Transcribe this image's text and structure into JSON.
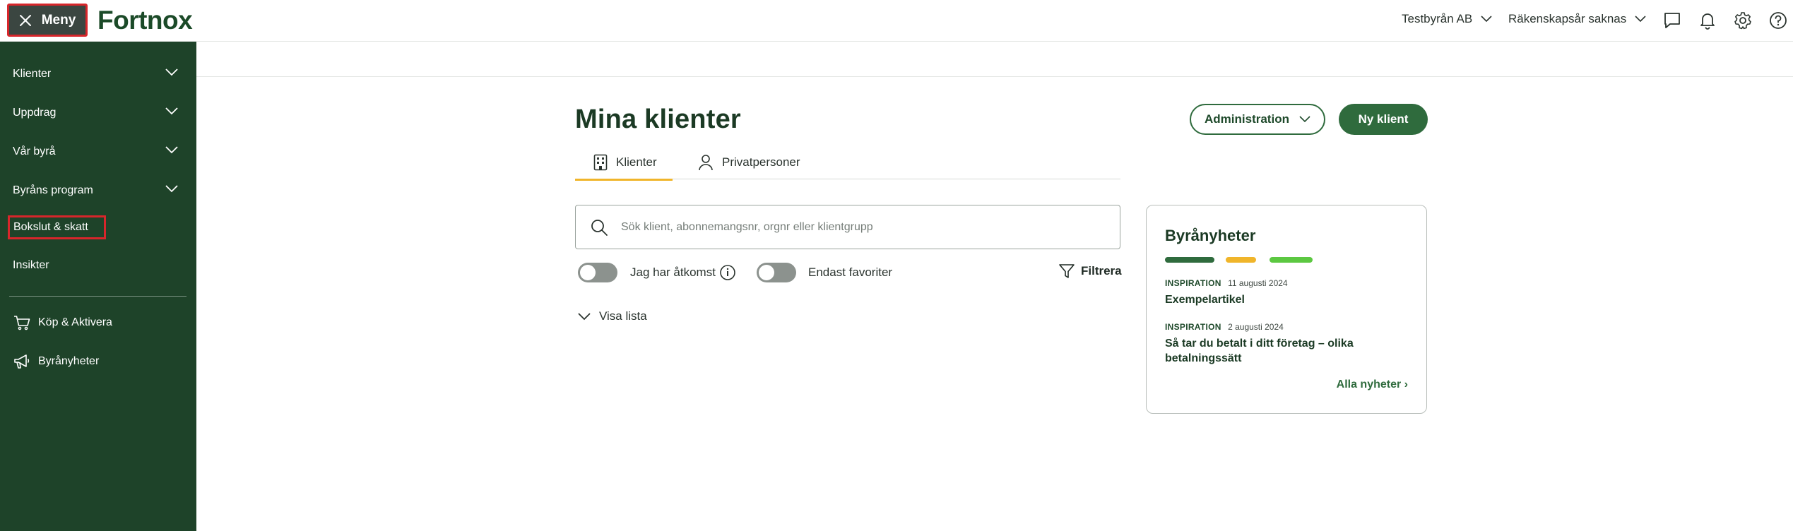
{
  "topbar": {
    "menu_label": "Meny",
    "logo_text": "Fortnox",
    "company_select": "Testbyrån AB",
    "fiscal_select": "Räkenskapsår saknas"
  },
  "sidebar": {
    "items": [
      {
        "label": "Klienter"
      },
      {
        "label": "Uppdrag"
      },
      {
        "label": "Vår byrå"
      },
      {
        "label": "Byråns program"
      },
      {
        "label": "Bokslut & skatt"
      },
      {
        "label": "Insikter"
      },
      {
        "label": "Köp & Aktivera"
      },
      {
        "label": "Byrånyheter"
      }
    ]
  },
  "main": {
    "title": "Mina klienter",
    "admin_button": "Administration",
    "new_client_button": "Ny klient",
    "tabs": [
      {
        "label": "Klienter"
      },
      {
        "label": "Privatpersoner"
      }
    ],
    "search": {
      "placeholder": "Sök klient, abonnemangsnr, orgnr eller klientgrupp"
    },
    "toggle_access": "Jag har åtkomst",
    "toggle_favorites": "Endast favoriter",
    "filter_label": "Filtrera",
    "show_list": "Visa lista"
  },
  "news": {
    "heading": "Byrånyheter",
    "bar_colors": [
      "#2f6b3d",
      "#f0b52a",
      "#5cc841"
    ],
    "items": [
      {
        "category": "INSPIRATION",
        "date": "11 augusti 2024",
        "title": "Exempelartikel"
      },
      {
        "category": "INSPIRATION",
        "date": "2 augusti 2024",
        "title": "Så tar du betalt i ditt företag – olika betalningssätt"
      }
    ],
    "all_link": "Alla nyheter ›"
  },
  "colors": {
    "sidebar": "#1e4329",
    "brand_green": "#2f6b3d",
    "accent_yellow": "#f0b52a",
    "highlight_red": "#d7262b"
  }
}
